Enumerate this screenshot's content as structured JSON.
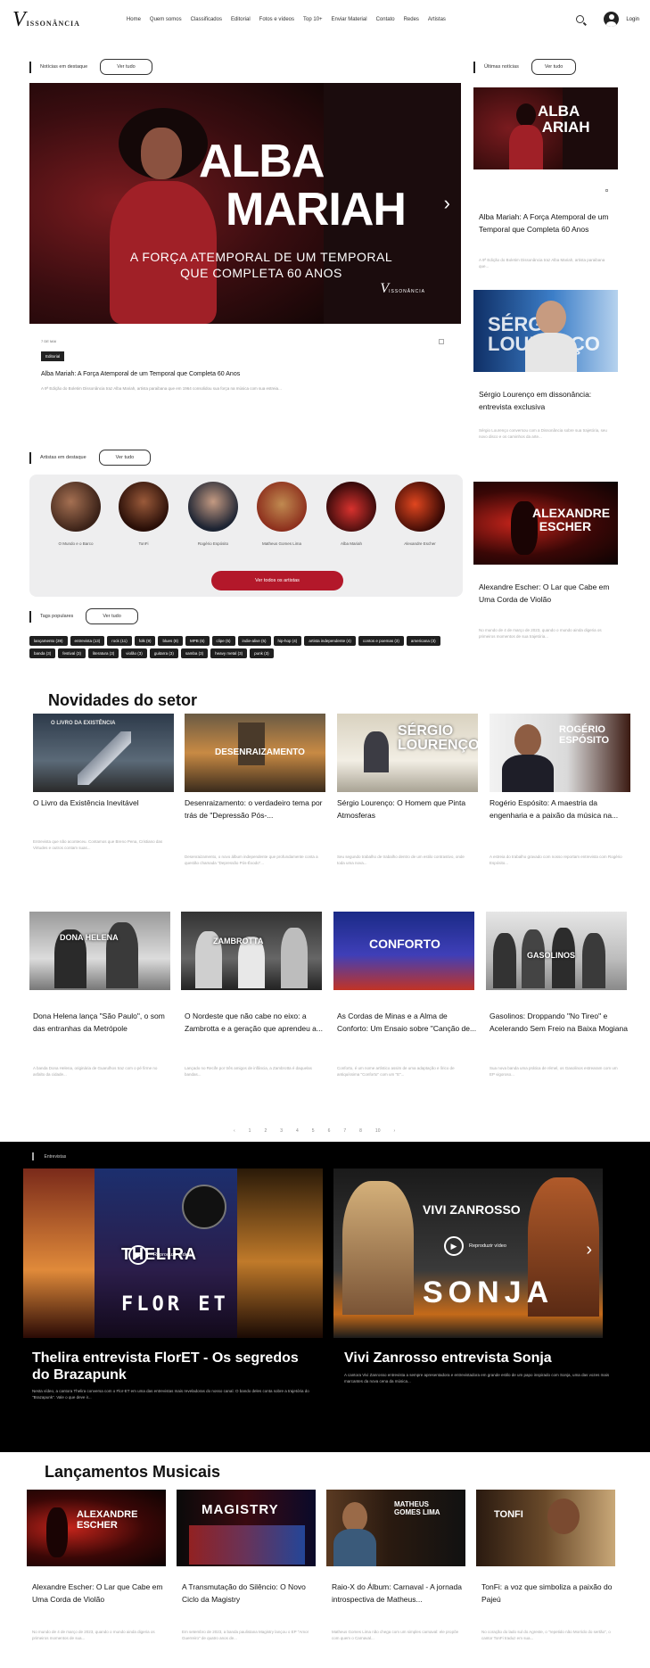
{
  "header": {
    "logo_letter": "V",
    "logo_text": "ISSONÂNCIA",
    "nav": [
      "Home",
      "Quem somos",
      "Classificados",
      "Editorial",
      "Fotos e vídeos",
      "Top 10+",
      "Enviar Material",
      "Contato",
      "Redes",
      "Artistas"
    ],
    "login": "Login"
  },
  "featured": {
    "label": "Notícias em destaque",
    "see_all": "Ver tudo",
    "hero_line1": "ALBA",
    "hero_line2": "MARIAH",
    "hero_sub": "A FORÇA ATEMPORAL DE UM TEMPORAL QUE COMPLETA 60 ANOS",
    "hero_logo": "V",
    "hero_logo_text": "ISSONÂNCIA",
    "date": "7 DE MAI",
    "badge": "Editorial",
    "title": "Alba Mariah: A Força Atemporal de um Temporal que Completa 60 Anos",
    "excerpt": "A 9ª Edição do Boletim Dissonância traz Alba Mariah, artista paraibana que em 1964 consolidou sua força na música com sua estreia..."
  },
  "latest": {
    "label": "Últimas notícias",
    "see_all": "Ver tudo",
    "items": [
      {
        "title": "Alba Mariah: A Força Atemporal de um Temporal que Completa 60 Anos",
        "excerpt": "A 9ª Edição do Boletim Dissonância traz Alba Mariah, artista paraibana que..."
      },
      {
        "title": "Sérgio Lourenço em dissonância: entrevista exclusiva",
        "excerpt": "Sérgio Lourenço conversou com a Dissonância sobre sua trajetória, seu novo disco e os caminhos da arte..."
      },
      {
        "title": "Alexandre Escher: O Lar que Cabe em Uma Corda de Violão",
        "excerpt": "No mundo de 4 de março de 2023, quando o mundo ainda digeria os primeiros momentos de sua trajetória..."
      }
    ]
  },
  "artists": {
    "label": "Artistas em destaque",
    "see_all": "Ver tudo",
    "items": [
      "O Mundo e o Barco",
      "TonFi",
      "Rogério Espósito",
      "Matheus Gomes Lima",
      "Alba Mariah",
      "Alexandre Escher"
    ],
    "see_all_artists": "Ver todos os artistas"
  },
  "tags": {
    "label": "Tags populares",
    "see_all": "Ver tudo",
    "items": [
      "lançamento (39)",
      "entrevista (13)",
      "rock (11)",
      "folk (9)",
      "blues (8)",
      "MPB (6)",
      "clipe (5)",
      "indie-alive (5)",
      "hip-hop (4)",
      "artista independente (4)",
      "contos e poemas (3)",
      "americana (3)",
      "banda (3)",
      "festival (3)",
      "literatura (3)",
      "violão (3)",
      "guitarra (3)",
      "samba (3)",
      "heavy metal (3)",
      "punk (3)"
    ]
  },
  "industry_news": {
    "heading": "Novidades do setor",
    "row1": [
      {
        "img_text": "O LIVRO DA EXISTÊNCIA",
        "title": "O Livro da Existência Inevitável",
        "excerpt": "Entrevista que não aconteceu. Contamos que Breno Pena, Cristiano das Virtudes e outros contam suas..."
      },
      {
        "img_text": "DESENRAIZAMENTO",
        "title": "Desenraizamento: o verdadeiro tema por trás de \"Depressão Pós-...",
        "excerpt": "Desenraizamento, o novo álbum independente que profundamente conta a questão chamada \"Depressão Pós-Êxodo\"..."
      },
      {
        "img_text": "SÉRGIO LOURENÇO",
        "title": "Sérgio Lourenço: O Homem que Pinta Atmosferas",
        "excerpt": "Seu segundo trabalho de trabalho dentro de um estilo contrastivo, onde toda uma nova..."
      },
      {
        "img_text": "ROGÉRIO ESPÓSITO",
        "title": "Rogério Espósito: A maestria da engenharia e a paixão da música na...",
        "excerpt": "A estreia do trabalho gravado com nosso reportam entrevista com Rogério Espósito..."
      }
    ],
    "row2": [
      {
        "img_text": "DONA HELENA",
        "title": "Dona Helena lança \"São Paulo\", o som das entranhas da Metrópole",
        "excerpt": "A banda Dona Helena, originária de Guarulhos traz com o pé firme no asfalto da cidade..."
      },
      {
        "img_text": "ZAMBROTTA",
        "title": "O Nordeste que não cabe no eixo: a Zambrotta e a geração que aprendeu a...",
        "excerpt": "Lançado no Recife por três amigos de infância, a Zambrotta é daquelas bandas..."
      },
      {
        "img_text": "CONFORTO",
        "title": "As Cordas de Minas e a Alma de Conforto: Um Ensaio sobre \"Canção de...",
        "excerpt": "Conforto, é um nome artístico assim de uma adaptação e lírico de antiquíssima \"Conforto\" com um \"E\"..."
      },
      {
        "img_text": "GASOLINOS",
        "title": "Gasolinos: Droppando \"No Tireo\" e Acelerando Sem Freio na Baixa Mogiana",
        "excerpt": "Sua nova banda uma prática de rémel, os Gasolinos estrearam com um EP vigoroso..."
      }
    ],
    "pages": [
      "‹",
      "1",
      "2",
      "3",
      "4",
      "5",
      "6",
      "7",
      "8",
      "10",
      "›"
    ]
  },
  "videos": {
    "label": "Entrevistas",
    "play_label": "Reproduzir vídeo",
    "items": [
      {
        "img_line1": "THELIRA",
        "img_line2": "FLOR ET",
        "title": "Thelira entrevista FlorET - Os segredos do Brazapunk",
        "excerpt": "Nesta vídeo, a cantora Thelira conversa com o Flor-ET em uma das entrevistas mais reveladoras do nosso canal. O bando deles conta sobre a trajetória do \"Brazapunk\". Vale o que deve ir..."
      },
      {
        "img_line1": "VIVI ZANROSSO",
        "img_line2": "SONJA",
        "title": "Vivi Zanrosso entrevista Sonja",
        "excerpt": "A cantora Vivi Zanrosso entrevista a sempre apresentadora e entrevistadora em grande estilo de um papo inspirado com Sonja, uma das vozes mais marcantes da nova cena da música..."
      }
    ]
  },
  "releases": {
    "heading": "Lançamentos Musicais",
    "items": [
      {
        "img_text": "ALEXANDRE ESCHER",
        "title": "Alexandre Escher: O Lar que Cabe em Uma Corda de Violão",
        "excerpt": "No mundo de 4 de março de 2023, quando o mundo ainda digeria os primeiros momentos de sua..."
      },
      {
        "img_text": "MAGISTRY",
        "title": "A Transmutação do Silêncio: O Novo Ciclo da Magistry",
        "excerpt": "Em setembro de 2023, a banda paulistana Magistry lançou o EP \"Amor Guerreiro\" de quatro anos de..."
      },
      {
        "img_text": "MATHEUS GOMES LIMA",
        "title": "Raio-X do Álbum: Carnaval - A jornada introspectiva de Matheus...",
        "excerpt": "Matheus Gomes Lima não chega com um simples carnaval: ele propõe com quem o Carnaval..."
      },
      {
        "img_text": "TONFI",
        "title": "TonFi: a voz que simboliza a paixão do Pajeú",
        "excerpt": "No coração do lado sul do Agreste, o \"repetido não Morrido do sertão\", o cantor TonFi traduz em sua..."
      }
    ]
  }
}
